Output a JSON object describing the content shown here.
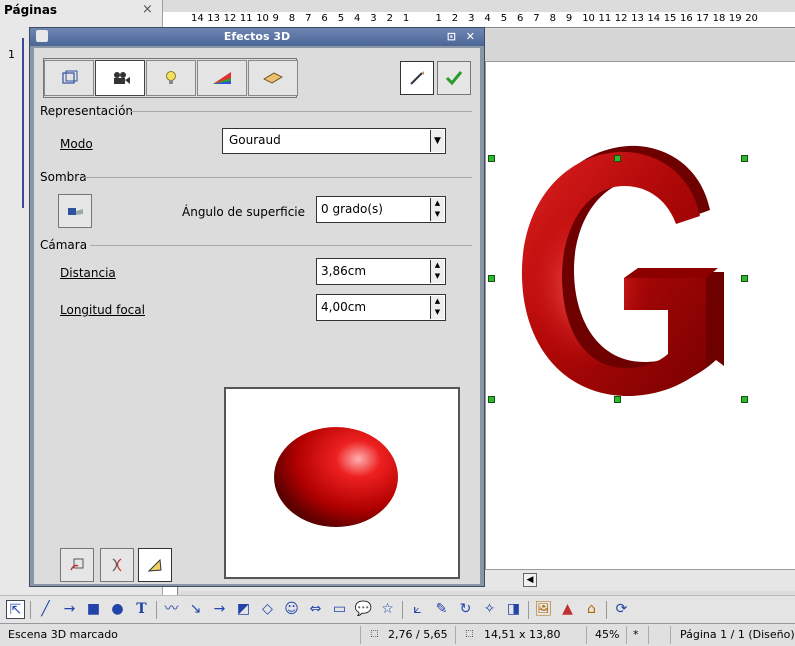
{
  "pages_panel": {
    "title": "Páginas",
    "close": "×",
    "page_number": "1"
  },
  "ruler": {
    "ticks": [
      "14",
      "13",
      "12",
      "11",
      "10",
      "9",
      "8",
      "7",
      "6",
      "5",
      "4",
      "3",
      "2",
      "1",
      "",
      "1",
      "2",
      "3",
      "4",
      "5",
      "6",
      "7",
      "8",
      "9",
      "10",
      "11",
      "12",
      "13",
      "14",
      "15",
      "16",
      "17",
      "18",
      "19",
      "20"
    ]
  },
  "dialog": {
    "title": "Efectos 3D",
    "title_buttons": "⊡ ✕",
    "tabs": [
      {
        "name": "geometry",
        "icon": "geometry-icon"
      },
      {
        "name": "shading",
        "icon": "camera-icon"
      },
      {
        "name": "illumination",
        "icon": "lightbulb-icon"
      },
      {
        "name": "textures",
        "icon": "texture-icon"
      },
      {
        "name": "material",
        "icon": "material-icon"
      }
    ],
    "representacion": {
      "heading": "Representación",
      "modo_label": "Modo",
      "modo_value": "Gouraud"
    },
    "sombra": {
      "heading": "Sombra",
      "angulo_label": "Ángulo de superficie",
      "angulo_value": "0 grado(s)"
    },
    "camara": {
      "heading": "Cámara",
      "distancia_label": "Distancia",
      "distancia_value": "3,86cm",
      "focal_label": "Longitud focal",
      "focal_value": "4,00cm"
    }
  },
  "statusbar": {
    "message": "Escena 3D marcado",
    "position": "2,76 / 5,65",
    "size": "14,51 x 13,80",
    "zoom": "45%",
    "modified": "*",
    "page": "Página 1 / 1 (Diseño)"
  },
  "colors": {
    "accent": "#cc1111",
    "titlebar": "#5a72a4",
    "handle": "#2eb82e"
  }
}
